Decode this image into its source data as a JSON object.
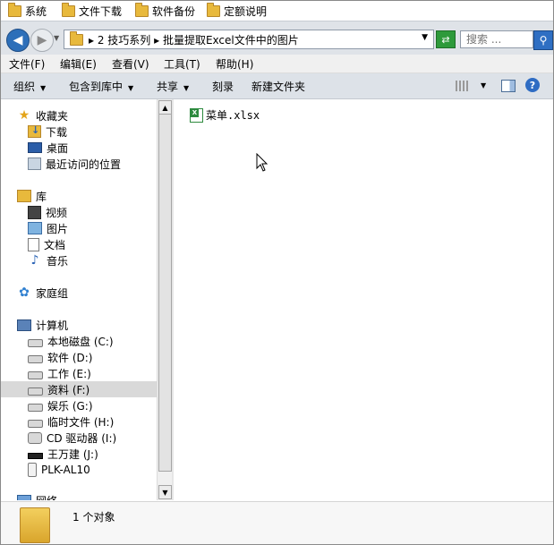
{
  "favorites": [
    {
      "label": "系统",
      "icon": "folder-icon"
    },
    {
      "label": "文件下载",
      "icon": "folder-icon"
    },
    {
      "label": "软件备份",
      "icon": "folder-icon"
    },
    {
      "label": "定额说明",
      "icon": "folder-icon"
    }
  ],
  "address": {
    "path": "▸ 2 技巧系列 ▸ 批量提取Excel文件中的图片",
    "search_placeholder": "搜索 ..."
  },
  "menu": [
    "文件(F)",
    "编辑(E)",
    "查看(V)",
    "工具(T)",
    "帮助(H)"
  ],
  "commands": {
    "organize": "组织",
    "include_library": "包含到库中",
    "share": "共享",
    "burn": "刻录",
    "new_folder": "新建文件夹"
  },
  "nav": {
    "favorites_header": "收藏夹",
    "favorites": [
      "下载",
      "桌面",
      "最近访问的位置"
    ],
    "libraries_header": "库",
    "libraries": [
      "视频",
      "图片",
      "文档",
      "音乐"
    ],
    "homegroup": "家庭组",
    "computer_header": "计算机",
    "drives": [
      "本地磁盘 (C:)",
      "软件 (D:)",
      "工作 (E:)",
      "资料 (F:)",
      "娱乐 (G:)",
      "临时文件 (H:)",
      "CD 驱动器 (I:)",
      "王万建 (J:)",
      "PLK-AL10"
    ],
    "selected_drive": "资料 (F:)",
    "network": "网络"
  },
  "files": [
    {
      "name": "菜单.xlsx",
      "icon": "excel-file-icon"
    }
  ],
  "status": {
    "count_text": "1 个对象"
  }
}
